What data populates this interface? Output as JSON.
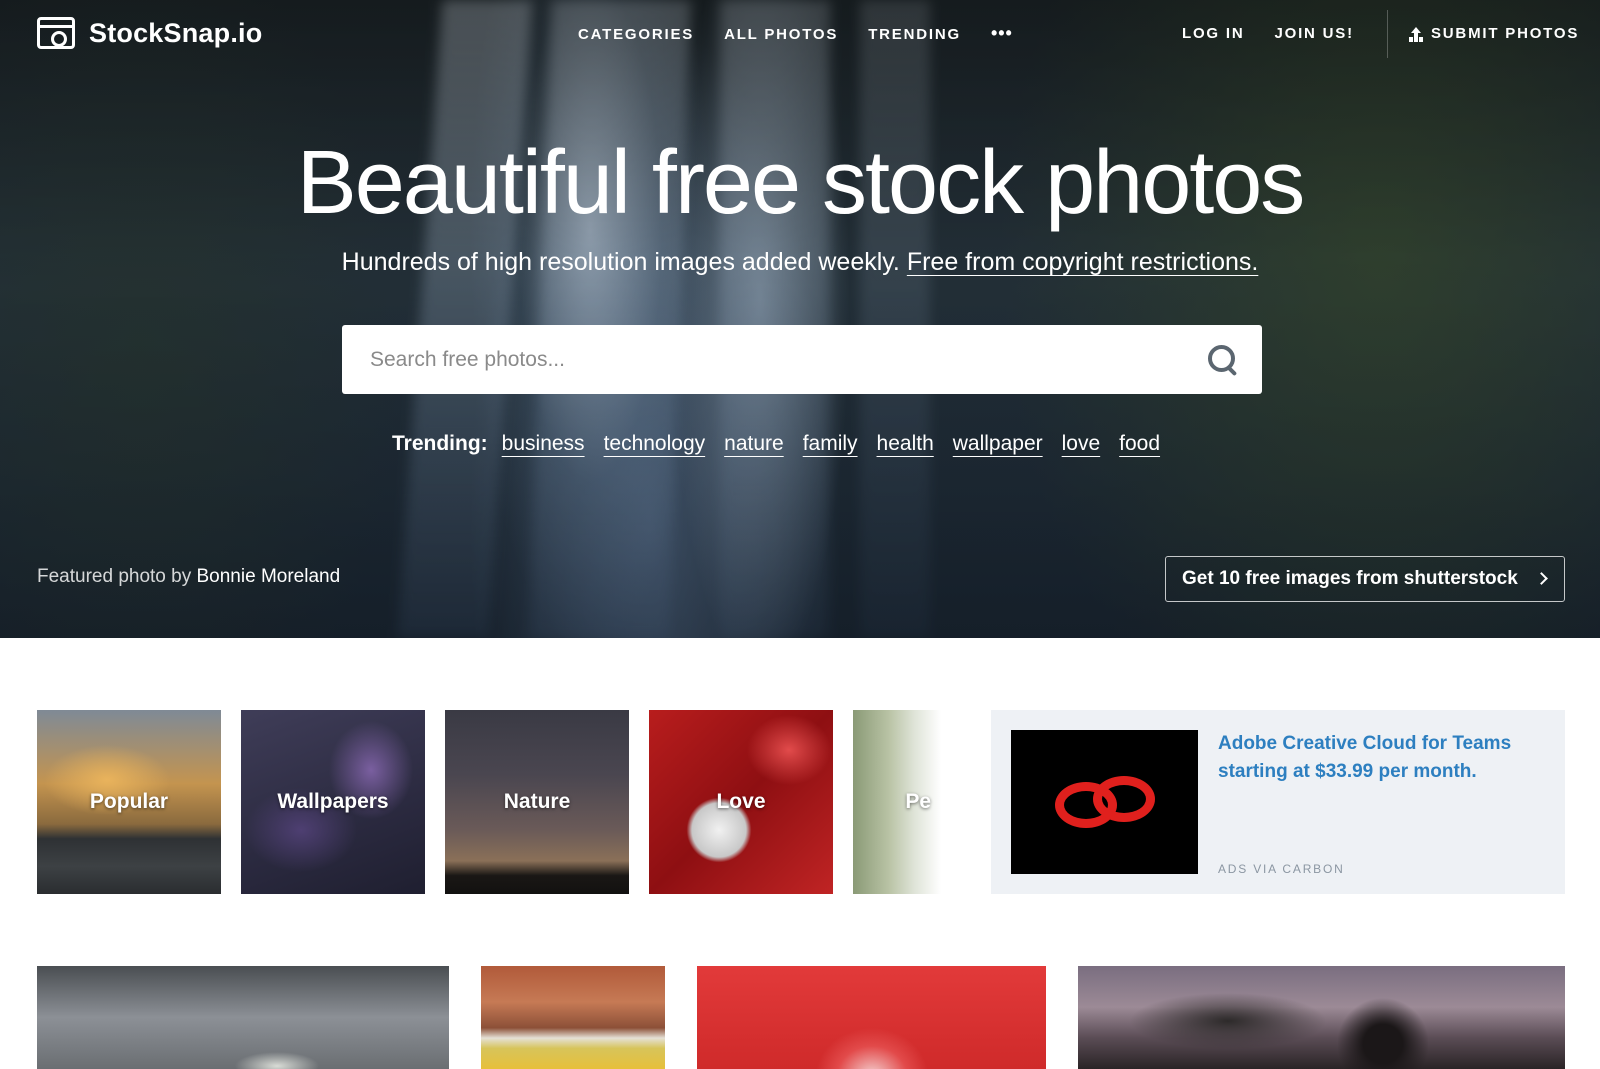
{
  "brand": {
    "name": "StockSnap.io"
  },
  "nav": {
    "center": [
      "CATEGORIES",
      "ALL PHOTOS",
      "TRENDING"
    ],
    "more": "•••",
    "right": [
      "LOG IN",
      "JOIN US!"
    ],
    "submit": "SUBMIT PHOTOS"
  },
  "hero": {
    "headline": "Beautiful free stock photos",
    "subline": "Hundreds of high resolution images added weekly.",
    "subline_link": "Free from copyright restrictions.",
    "search_placeholder": "Search free photos...",
    "trending_label": "Trending:",
    "trending": [
      "business",
      "technology",
      "nature",
      "family",
      "health",
      "wallpaper",
      "love",
      "food"
    ],
    "credit_prefix": "Featured photo by",
    "credit_author": "Bonnie Moreland",
    "shutterstock_cta": "Get 10 free images from shutterstock"
  },
  "categories": [
    "Popular",
    "Wallpapers",
    "Nature",
    "Love",
    "Pe"
  ],
  "ad": {
    "text": "Adobe Creative Cloud for Teams starting at $33.99 per month.",
    "via": "ADS VIA CARBON",
    "logo_color": "#e0201d"
  },
  "colors": {
    "ad_link": "#2d7fc0",
    "ad_bg": "#eef1f5"
  }
}
